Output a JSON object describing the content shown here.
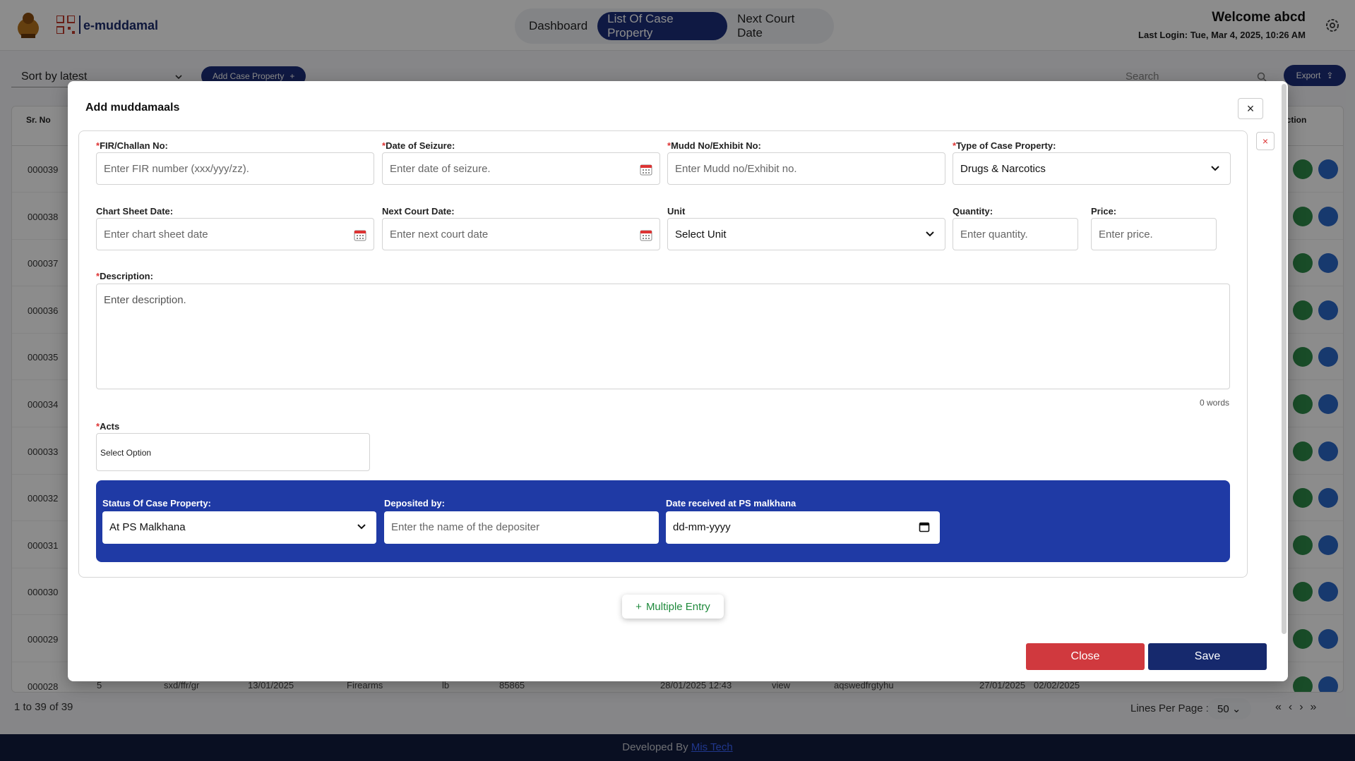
{
  "header": {
    "brand": "e-muddamal",
    "nav": [
      {
        "label": "Dashboard",
        "active": false
      },
      {
        "label": "List Of Case Property",
        "active": true
      },
      {
        "label": "Next Court Date",
        "active": false
      }
    ],
    "welcome": "Welcome abcd",
    "last_login": "Last Login: Tue, Mar 4, 2025, 10:26 AM"
  },
  "toolbar": {
    "sort_value": "Sort by latest",
    "add_label": "Add Case Property",
    "search_placeholder": "Search",
    "export_label": "Export"
  },
  "table": {
    "col_sr": "Sr. No",
    "col_action": "Action",
    "rows": [
      "000039",
      "000038",
      "000037",
      "000036",
      "000035",
      "000034",
      "000033",
      "000032",
      "000031",
      "000030",
      "000029",
      "000028"
    ],
    "last_row": {
      "col2": "5",
      "col3": "sxd/ffr/gr",
      "col4": "13/01/2025",
      "col5": "Firearms",
      "col6": "lb",
      "col7": "85865",
      "col8": "28/01/2025 12:43",
      "col9": "view",
      "col10": "aqswedfrgtyhu",
      "col11": "27/01/2025",
      "col12": "02/02/2025"
    },
    "pager_text": "1 to 39 of 39",
    "lines_per_page_label": "Lines Per Page :",
    "lines_per_page_value": "50"
  },
  "footer": {
    "prefix": "Developed By",
    "link": "Mis Tech"
  },
  "modal": {
    "title": "Add muddamaals",
    "fields": {
      "fir_label": "FIR/Challan No:",
      "fir_placeholder": "Enter FIR number (xxx/yyy/zz).",
      "seizure_label": "Date of Seizure:",
      "seizure_placeholder": "Enter date of seizure.",
      "mudd_label": "Mudd No/Exhibit No:",
      "mudd_placeholder": "Enter Mudd no/Exhibit no.",
      "type_label": "Type of Case Property:",
      "type_value": "Drugs & Narcotics",
      "chart_label": "Chart Sheet Date:",
      "chart_placeholder": "Enter chart sheet date",
      "next_court_label": "Next Court Date:",
      "next_court_placeholder": "Enter next court date",
      "unit_label": "Unit",
      "unit_value": "Select Unit",
      "quantity_label": "Quantity:",
      "quantity_placeholder": "Enter quantity.",
      "price_label": "Price:",
      "price_placeholder": "Enter price.",
      "description_label": "Description:",
      "description_placeholder": "Enter description.",
      "word_count": "0 words",
      "acts_label": "Acts",
      "acts_value": "Select Option",
      "status_label": "Status Of Case Property:",
      "status_value": "At PS Malkhana",
      "deposited_label": "Deposited by:",
      "deposited_placeholder": "Enter the name of the depositer",
      "received_label": "Date received at PS malkhana",
      "received_value": "dd-mm-yyyy"
    },
    "multiple_entry_label": "Multiple Entry",
    "close_label": "Close",
    "save_label": "Save"
  },
  "colors": {
    "primary": "#1d2f7a",
    "band": "#1f3aa5",
    "danger": "#d0393e",
    "success": "#1f8a3c"
  }
}
